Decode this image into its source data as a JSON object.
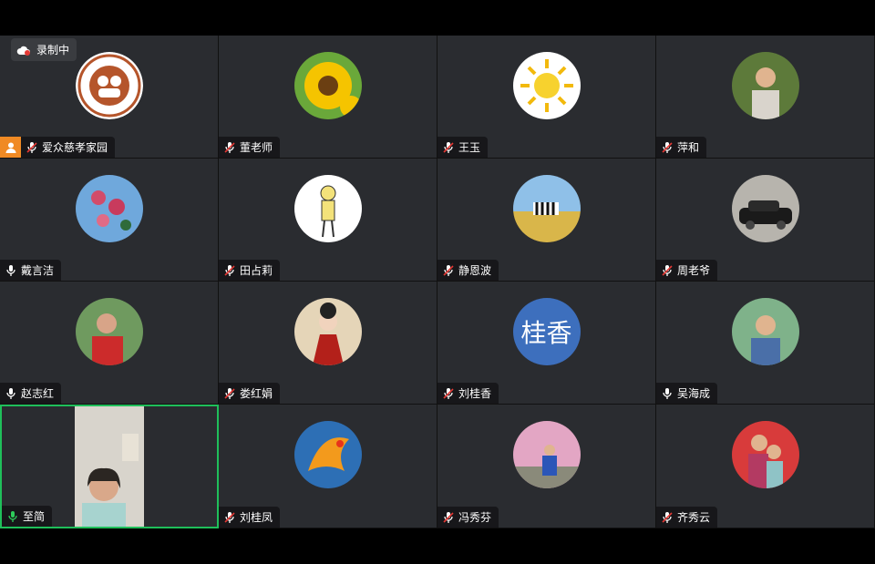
{
  "recording": {
    "label": "录制中",
    "icon": "cloud-record-icon"
  },
  "colors": {
    "active_border": "#1fbf5a",
    "host_badge": "#f08a24",
    "tile_bg": "#2a2c30",
    "text_avatar_bg": "#3d6fbd"
  },
  "participants": [
    {
      "name": "爱众慈孝家园",
      "mic": "muted",
      "host": true,
      "avatar": "logo"
    },
    {
      "name": "董老师",
      "mic": "muted",
      "avatar": "sunflower"
    },
    {
      "name": "王玉",
      "mic": "muted",
      "avatar": "sun-drawing"
    },
    {
      "name": "萍和",
      "mic": "muted",
      "avatar": "photo-person"
    },
    {
      "name": "戴言洁",
      "mic": "on",
      "avatar": "flowers"
    },
    {
      "name": "田占莉",
      "mic": "muted",
      "avatar": "sketch"
    },
    {
      "name": "静恩波",
      "mic": "muted",
      "avatar": "zebra"
    },
    {
      "name": "周老爷",
      "mic": "muted",
      "avatar": "car"
    },
    {
      "name": "赵志红",
      "mic": "on",
      "avatar": "photo-woman"
    },
    {
      "name": "娄红娟",
      "mic": "muted",
      "avatar": "painting-woman"
    },
    {
      "name": "刘桂香",
      "mic": "muted",
      "avatar": "text",
      "avatar_text": "桂香"
    },
    {
      "name": "吴海成",
      "mic": "on",
      "avatar": "photo-man"
    },
    {
      "name": "至简",
      "mic": "speaking",
      "avatar": "video",
      "active": true
    },
    {
      "name": "刘桂凤",
      "mic": "muted",
      "avatar": "phoenix"
    },
    {
      "name": "冯秀芬",
      "mic": "muted",
      "avatar": "photo-blossom"
    },
    {
      "name": "齐秀云",
      "mic": "muted",
      "avatar": "photo-family"
    }
  ]
}
